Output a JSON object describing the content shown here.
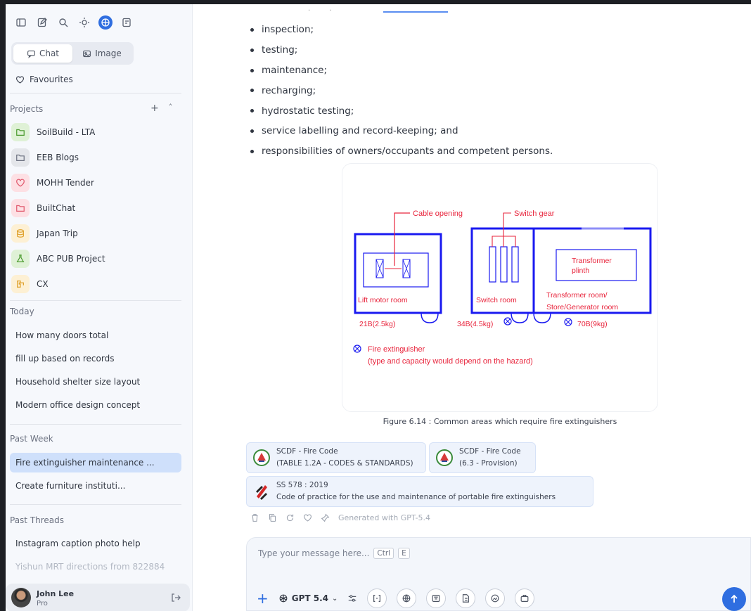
{
  "sidebar": {
    "modes": {
      "chat": "Chat",
      "image": "Image"
    },
    "favourites": "Favourites",
    "projects_title": "Projects",
    "projects": [
      {
        "label": "SoilBuild - LTA",
        "color": "#dff1d6",
        "icon_color": "#4a9a2e"
      },
      {
        "label": "EEB Blogs",
        "color": "#e4e6ea",
        "icon_color": "#6b7180"
      },
      {
        "label": "MOHH Tender",
        "color": "#fde0e4",
        "icon_color": "#e0576b"
      },
      {
        "label": "BuiltChat",
        "color": "#fde0e4",
        "icon_color": "#e0576b"
      },
      {
        "label": "Japan Trip",
        "color": "#fdf0d4",
        "icon_color": "#e0a22e"
      },
      {
        "label": "ABC PUB Project",
        "color": "#dff1d6",
        "icon_color": "#4a9a2e"
      },
      {
        "label": "CX",
        "color": "#fdf0d4",
        "icon_color": "#e0a22e"
      }
    ],
    "today_title": "Today",
    "today": [
      "How many doors total",
      "fill up based on records",
      "Household shelter size layout",
      "Modern office design concept"
    ],
    "past_week_title": "Past Week",
    "past_week": [
      "Fire extinguisher maintenance ...",
      "Create furniture instituti..."
    ],
    "past_threads_title": "Past Threads",
    "past_threads": [
      "Instagram caption photo help",
      "Yishun MRT directions from 822884"
    ],
    "user": {
      "name": "John Lee",
      "plan": "Pro"
    }
  },
  "main": {
    "bullets": [
      "inspection;",
      "testing;",
      "maintenance;",
      "recharging;",
      "hydrostatic testing;",
      "service labelling and record-keeping; and",
      "responsibilities of owners/occupants and competent persons."
    ],
    "figure": {
      "cable_opening": "Cable opening",
      "switch_gear": "Switch gear",
      "transformer_plinth": "Transformer plinth",
      "lift_motor_room": "Lift motor room",
      "switch_room": "Switch room",
      "transformer_room_line1": "Transformer room/",
      "transformer_room_line2": "Store/Generator room",
      "ext1": "21B(2.5kg)",
      "ext2": "34B(4.5kg)",
      "ext3": "70B(9kg)",
      "legend_title": "Fire extinguisher",
      "legend_sub": "(type and capacity would depend on the hazard)",
      "caption": "Figure 6.14 : Common areas which require fire extinguishers"
    },
    "citations": [
      {
        "line1": "SCDF - Fire Code",
        "line2": "(TABLE 1.2A - CODES & STANDARDS)"
      },
      {
        "line1": "SCDF - Fire Code",
        "line2": "(6.3 - Provision)"
      },
      {
        "line1": "SS 578 : 2019",
        "line2": "Code of practice for the use and maintenance of portable fire extinguishers"
      }
    ],
    "generated": "Generated with GPT-5.4",
    "composer": {
      "placeholder": "Type your message here...",
      "shortcut1": "Ctrl",
      "shortcut2": "E",
      "model": "GPT 5.4"
    }
  },
  "colors": {
    "accent": "#2f6ee0",
    "diagram_blue": "#1a1af0",
    "diagram_red": "#e8243c",
    "selected_thread": "#cfe0fb"
  }
}
